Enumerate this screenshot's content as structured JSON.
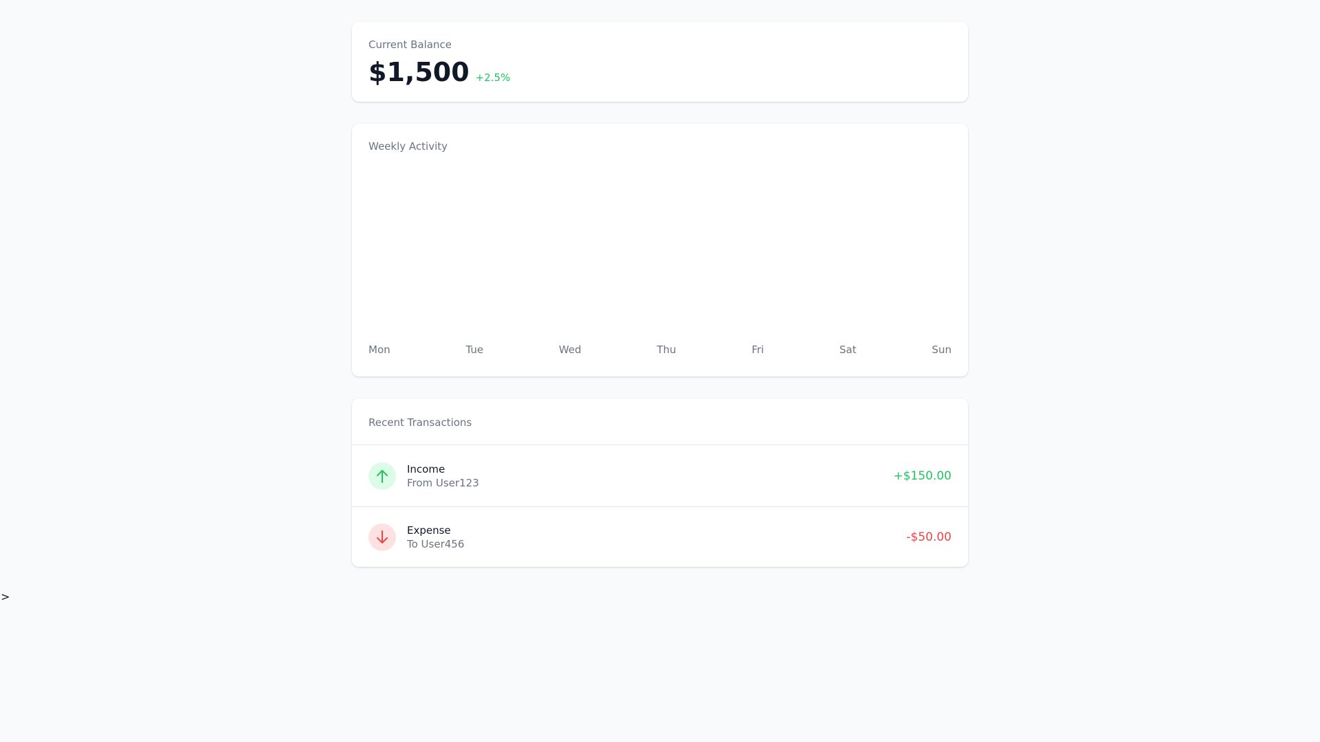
{
  "balance": {
    "label": "Current Balance",
    "amount": "$1,500",
    "change": "+2.5%"
  },
  "activity": {
    "title": "Weekly Activity",
    "days": [
      "Mon",
      "Tue",
      "Wed",
      "Thu",
      "Fri",
      "Sat",
      "Sun"
    ]
  },
  "transactions": {
    "title": "Recent Transactions",
    "items": [
      {
        "type": "income",
        "icon": "arrow-up-icon",
        "title": "Income",
        "subtitle": "From User123",
        "amount": "+$150.00"
      },
      {
        "type": "expense",
        "icon": "arrow-down-icon",
        "title": "Expense",
        "subtitle": "To User456",
        "amount": "-$50.00"
      }
    ]
  },
  "stray_text": ">",
  "colors": {
    "positive": "#22c55e",
    "negative": "#ef4444",
    "background": "#f9fafb"
  }
}
